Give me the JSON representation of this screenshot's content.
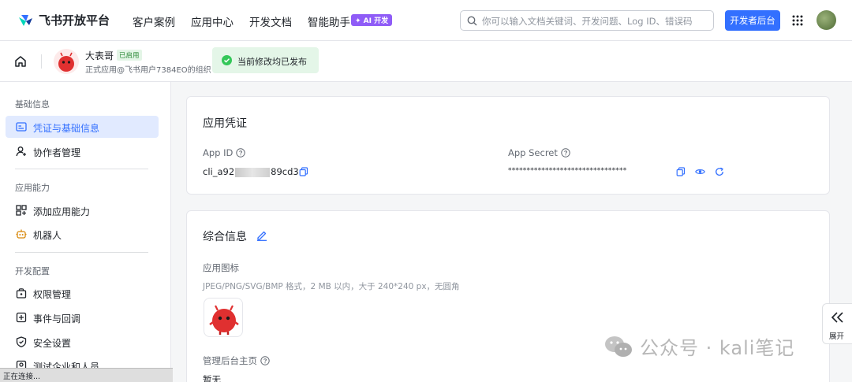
{
  "nav": {
    "brand": "飞书开放平台",
    "links": [
      "客户案例",
      "应用中心",
      "开发文档",
      "智能助手"
    ],
    "ai_badge": "✦ AI 开发",
    "search_placeholder": "你可以输入文档关键词、开发问题、Log ID、错误码",
    "dev_console": "开发者后台"
  },
  "app": {
    "name": "大表哥",
    "status": "已启用",
    "org": "正式应用@飞书用户7384EO的组织",
    "publish_status": "当前修改均已发布"
  },
  "sidebar": {
    "section1": "基础信息",
    "item_credentials": "凭证与基础信息",
    "item_collaborators": "协作者管理",
    "section2": "应用能力",
    "item_add_capability": "添加应用能力",
    "item_bot": "机器人",
    "section3": "开发配置",
    "item_permissions": "权限管理",
    "item_events": "事件与回调",
    "item_security": "安全设置",
    "item_testing": "测试企业和人员"
  },
  "browser_status": "正在连接...",
  "credentials": {
    "title": "应用凭证",
    "app_id_label": "App ID",
    "app_id_prefix": "cli_a92",
    "app_id_suffix": "89cd3",
    "app_secret_label": "App Secret",
    "app_secret_masked": "********************************"
  },
  "general": {
    "title": "综合信息",
    "icon_label": "应用图标",
    "icon_hint": "JPEG/PNG/SVG/BMP 格式，2 MB 以内，大于 240*240 px，无圆角",
    "homepage_label": "管理后台主页",
    "homepage_value": "暂无"
  },
  "expand_label": "展开",
  "watermark": "公众号 · kali笔记",
  "colors": {
    "primary": "#3370ff",
    "success": "#34c759",
    "ai_purple": "#8f5cf7"
  }
}
